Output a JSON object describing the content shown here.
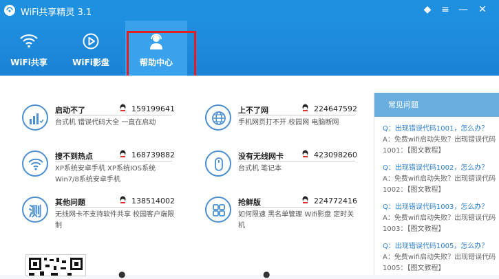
{
  "app": {
    "title": "WiFi共享精灵 3.1"
  },
  "window_controls": {
    "skin": "◆",
    "menu": "≡",
    "minimize": "—",
    "close": "✕"
  },
  "toolbar": {
    "buttons": [
      {
        "label": "WiFi共享",
        "icon": "wifi-icon"
      },
      {
        "label": "WiFi影盘",
        "icon": "play-icon"
      },
      {
        "label": "帮助中心",
        "icon": "support-agent-icon",
        "active": true
      }
    ]
  },
  "help_items": [
    {
      "title": "启动不了",
      "qq": "159199641",
      "desc": "台式机   错误代码大全   一直在启动",
      "icon": "signal-bars-icon"
    },
    {
      "title": "上不了网",
      "qq": "224647592",
      "desc": "手机网页打不开   校园网   电脑断网",
      "icon": "globe-icon"
    },
    {
      "title": "搜不到热点",
      "qq": "168739882",
      "desc": "XP系统安卓手机   XP系统IOS系统   Win7/8系统安卓手机",
      "icon": "wifi-icon"
    },
    {
      "title": "没有无线网卡",
      "qq": "423098260",
      "desc": "台式机   笔记本",
      "icon": "mouse-icon"
    },
    {
      "title": "其他问题",
      "qq": "138514002",
      "desc": "无线网卡不支持软件共享   校园客户端限制",
      "icon": "test-icon",
      "glyph": "测"
    },
    {
      "title": "抢鲜版",
      "qq": "224772416",
      "desc": "如何限速   黑名单管理   Wifi影盘   定时关机",
      "icon": "grid-icon"
    }
  ],
  "faq": {
    "title": "常见问题",
    "items": [
      {
        "q": "Q：出现错误代码1001，怎么办？",
        "a": "A：免费wifi启动失败？出现错误代码1001：【图文教程】"
      },
      {
        "q": "Q：出现错误代码1002，怎么办？",
        "a": "A：免费wifi启动失败？出现错误代码1002：【图文教程】"
      },
      {
        "q": "Q：出现错误代码1003，怎么办？",
        "a": "A：免费wifi启动失败？出现错误代码1003：【图文教程】"
      },
      {
        "q": "Q：出现错误代码1005，怎么办？",
        "a": "A：免费wifi启动失败？出现错误代码1005：【图文教程】"
      }
    ]
  },
  "colors": {
    "brand": "#1f8fe0",
    "accent": "#4b8fd0",
    "highlight_box": "#e02020",
    "link": "#2b7fd0"
  }
}
